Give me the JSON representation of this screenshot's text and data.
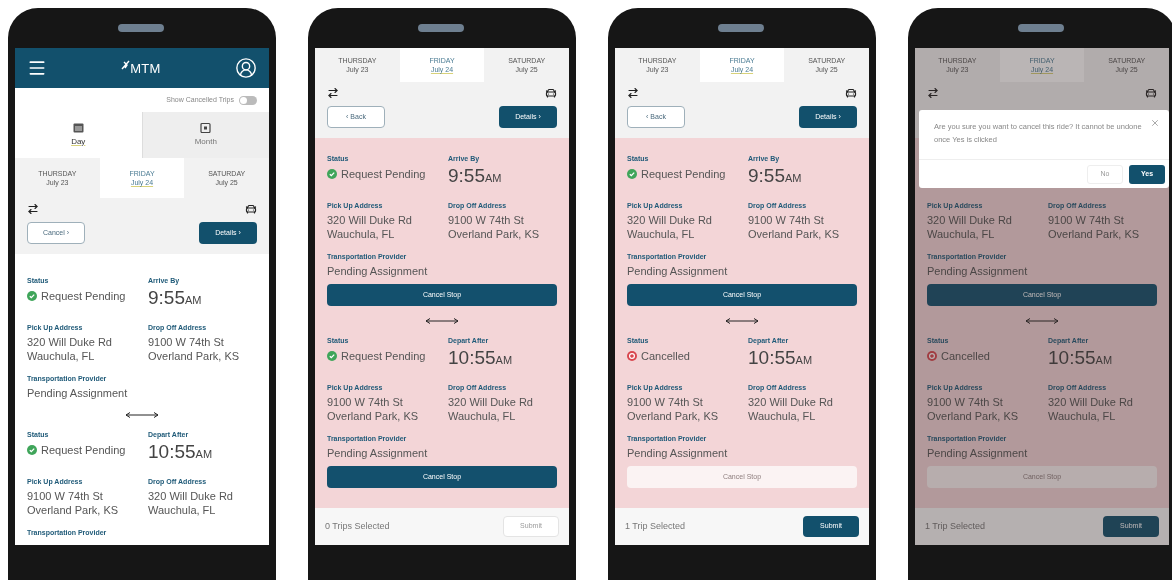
{
  "phones": [
    {
      "header": {
        "logo": "MTM"
      },
      "toggle": {
        "label": "Show Cancelled Trips",
        "on": false
      },
      "view_tabs": [
        {
          "label": "Day",
          "selected": true
        },
        {
          "label": "Month",
          "selected": false
        }
      ],
      "date_tabs": [
        {
          "day": "THURSDAY",
          "date": "July 23",
          "selected": false
        },
        {
          "day": "FRIDAY",
          "date": "July 24",
          "selected": true
        },
        {
          "day": "SATURDAY",
          "date": "July 25",
          "selected": false
        }
      ],
      "actions": [
        {
          "label": "Cancel ›",
          "kind": "outline"
        },
        {
          "label": "Details ›",
          "kind": "primary"
        }
      ],
      "highlighted": false,
      "dimmed": false,
      "trips": [
        {
          "status_label": "Status",
          "status": {
            "text": "Request Pending",
            "kind": "ok"
          },
          "time_label": "Arrive By",
          "time": "9:55",
          "meridiem": "AM",
          "pickup_label": "Pick Up Address",
          "pickup": [
            "320 Will Duke Rd",
            "Wauchula, FL"
          ],
          "dropoff_label": "Drop Off Address",
          "dropoff": [
            "9100 W 74th St",
            "Overland Park, KS"
          ],
          "provider_label": "Transportation Provider",
          "provider": "Pending Assignment"
        },
        {
          "status_label": "Status",
          "status": {
            "text": "Request Pending",
            "kind": "ok"
          },
          "time_label": "Depart After",
          "time": "10:55",
          "meridiem": "AM",
          "pickup_label": "Pick Up Address",
          "pickup": [
            "9100 W 74th St",
            "Overland Park, KS"
          ],
          "dropoff_label": "Drop Off Address",
          "dropoff": [
            "320 Will Duke Rd",
            "Wauchula, FL"
          ],
          "provider_label": "Transportation Provider"
        }
      ]
    },
    {
      "date_tabs": [
        {
          "day": "THURSDAY",
          "date": "July 23",
          "selected": false
        },
        {
          "day": "FRIDAY",
          "date": "July 24",
          "selected": true
        },
        {
          "day": "SATURDAY",
          "date": "July 25",
          "selected": false
        }
      ],
      "actions": [
        {
          "label": "‹ Back",
          "kind": "outline"
        },
        {
          "label": "Details ›",
          "kind": "primary"
        }
      ],
      "highlighted": true,
      "dimmed": false,
      "trips": [
        {
          "status_label": "Status",
          "status": {
            "text": "Request Pending",
            "kind": "ok"
          },
          "time_label": "Arrive By",
          "time": "9:55",
          "meridiem": "AM",
          "pickup_label": "Pick Up Address",
          "pickup": [
            "320 Will Duke Rd",
            "Wauchula, FL"
          ],
          "dropoff_label": "Drop Off Address",
          "dropoff": [
            "9100 W 74th St",
            "Overland Park, KS"
          ],
          "provider_label": "Transportation Provider",
          "provider": "Pending Assignment",
          "cancel_button": {
            "label": "Cancel Stop",
            "disabled": false
          }
        },
        {
          "status_label": "Status",
          "status": {
            "text": "Request Pending",
            "kind": "ok"
          },
          "time_label": "Depart After",
          "time": "10:55",
          "meridiem": "AM",
          "pickup_label": "Pick Up Address",
          "pickup": [
            "9100 W 74th St",
            "Overland Park, KS"
          ],
          "dropoff_label": "Drop Off Address",
          "dropoff": [
            "320 Will Duke Rd",
            "Wauchula, FL"
          ],
          "provider_label": "Transportation Provider",
          "provider": "Pending Assignment",
          "cancel_button": {
            "label": "Cancel Stop",
            "disabled": false
          }
        }
      ],
      "footer": {
        "count": "0 Trips Selected",
        "submit": {
          "label": "Submit",
          "disabled": true
        }
      }
    },
    {
      "date_tabs": [
        {
          "day": "THURSDAY",
          "date": "July 23",
          "selected": false
        },
        {
          "day": "FRIDAY",
          "date": "July 24",
          "selected": true
        },
        {
          "day": "SATURDAY",
          "date": "July 25",
          "selected": false
        }
      ],
      "actions": [
        {
          "label": "‹ Back",
          "kind": "outline"
        },
        {
          "label": "Details ›",
          "kind": "primary"
        }
      ],
      "highlighted": true,
      "dimmed": false,
      "trips": [
        {
          "status_label": "Status",
          "status": {
            "text": "Request Pending",
            "kind": "ok"
          },
          "time_label": "Arrive By",
          "time": "9:55",
          "meridiem": "AM",
          "pickup_label": "Pick Up Address",
          "pickup": [
            "320 Will Duke Rd",
            "Wauchula, FL"
          ],
          "dropoff_label": "Drop Off Address",
          "dropoff": [
            "9100 W 74th St",
            "Overland Park, KS"
          ],
          "provider_label": "Transportation Provider",
          "provider": "Pending Assignment",
          "cancel_button": {
            "label": "Cancel Stop",
            "disabled": false
          }
        },
        {
          "status_label": "Status",
          "status": {
            "text": "Cancelled",
            "kind": "cancelled"
          },
          "time_label": "Depart After",
          "time": "10:55",
          "meridiem": "AM",
          "pickup_label": "Pick Up Address",
          "pickup": [
            "9100 W 74th St",
            "Overland Park, KS"
          ],
          "dropoff_label": "Drop Off Address",
          "dropoff": [
            "320 Will Duke Rd",
            "Wauchula, FL"
          ],
          "provider_label": "Transportation Provider",
          "provider": "Pending Assignment",
          "cancel_button": {
            "label": "Cancel Stop",
            "disabled": true
          }
        }
      ],
      "footer": {
        "count": "1 Trip Selected",
        "submit": {
          "label": "Submit",
          "disabled": false
        }
      }
    },
    {
      "date_tabs": [
        {
          "day": "THURSDAY",
          "date": "July 23",
          "selected": false
        },
        {
          "day": "FRIDAY",
          "date": "July 24",
          "selected": true
        },
        {
          "day": "SATURDAY",
          "date": "July 25",
          "selected": false
        }
      ],
      "highlighted": true,
      "dimmed": true,
      "dialog": {
        "message": "Are you sure you want to cancel this ride? It cannot be undone once Yes is clicked",
        "buttons": [
          {
            "label": "No",
            "kind": "secondary"
          },
          {
            "label": "Yes",
            "kind": "primary"
          }
        ]
      },
      "trips": [
        {
          "pickup_label": "Pick Up Address",
          "pickup": [
            "320 Will Duke Rd",
            "Wauchula, FL"
          ],
          "dropoff_label": "Drop Off Address",
          "dropoff": [
            "9100 W 74th St",
            "Overland Park, KS"
          ],
          "provider_label": "Transportation Provider",
          "provider": "Pending Assignment",
          "cancel_button": {
            "label": "Cancel Stop",
            "disabled": false
          }
        },
        {
          "status_label": "Status",
          "status": {
            "text": "Cancelled",
            "kind": "cancelled"
          },
          "time_label": "Depart After",
          "time": "10:55",
          "meridiem": "AM",
          "pickup_label": "Pick Up Address",
          "pickup": [
            "9100 W 74th St",
            "Overland Park, KS"
          ],
          "dropoff_label": "Drop Off Address",
          "dropoff": [
            "320 Will Duke Rd",
            "Wauchula, FL"
          ],
          "provider_label": "Transportation Provider",
          "provider": "Pending Assignment",
          "cancel_button": {
            "label": "Cancel Stop",
            "disabled": true
          }
        }
      ],
      "footer": {
        "count": "1 Trip Selected",
        "submit": {
          "label": "Submit",
          "disabled": false
        }
      }
    }
  ]
}
